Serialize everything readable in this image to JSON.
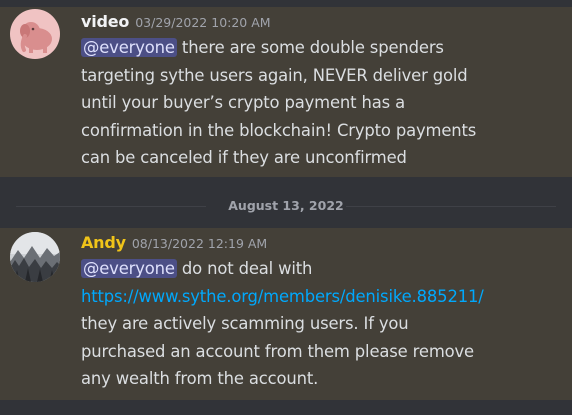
{
  "messages": [
    {
      "username": "video",
      "username_color": "#f2f3f5",
      "timestamp": "03/29/2022 10:20 AM",
      "mention": "@everyone",
      "lines": [
        " there are some double spenders",
        "targeting sythe users again, NEVER deliver gold",
        "until your buyer’s crypto payment has a",
        "confirmation in the blockchain!  Crypto payments",
        "can be canceled if they are unconfirmed"
      ]
    },
    {
      "username": "Andy",
      "username_color": "#f0c419",
      "timestamp": "08/13/2022 12:19 AM",
      "mention": "@everyone",
      "line1_rest": " do not deal with",
      "link": "https://www.sythe.org/members/denisike.885211/",
      "lines": [
        "they are actively scamming users. If you",
        "purchased an account from them please remove",
        "any wealth from the account."
      ]
    }
  ],
  "date_divider": "August 13, 2022",
  "avatars": {
    "video": "pink-elephant-icon",
    "andy": "snowy-forest-icon"
  },
  "colors": {
    "background": "#313338",
    "highlight": "#444038",
    "mention_bg": "#4c4f86",
    "link": "#00a8fc",
    "andy_name": "#f0c419"
  }
}
